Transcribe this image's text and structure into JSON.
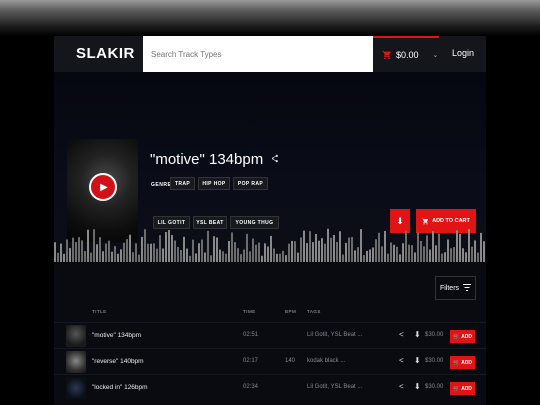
{
  "brand": "SLAKIR",
  "search": {
    "placeholder": "Search Track Types"
  },
  "cart": {
    "total": "$0.00"
  },
  "nav": {
    "login": "Login"
  },
  "track": {
    "title": "\"motive\" 134bpm",
    "genre_label": "GENRE",
    "genres": [
      "TRAP",
      "HIP HOP",
      "POP RAP"
    ],
    "tags": [
      "LIL GOTIT",
      "YSL BEAT",
      "YOUNG THUG"
    ],
    "add_to_cart": "ADD TO CART"
  },
  "filters": {
    "label": "Filters"
  },
  "table": {
    "headers": {
      "title": "TITLE",
      "time": "TIME",
      "bpm": "BPM",
      "tags": "TAGS"
    },
    "rows": [
      {
        "title": "\"motive\" 134bpm",
        "time": "02:51",
        "bpm": "",
        "tags": "Lil Gotit, YSL Beat ...",
        "price": "$30.00",
        "add": "ADD"
      },
      {
        "title": "\"reverse\" 140bpm",
        "time": "02:17",
        "bpm": "140",
        "tags": "kodak black ...",
        "price": "$30.00",
        "add": "ADD"
      },
      {
        "title": "\"locked in\" 126bpm",
        "time": "02:34",
        "bpm": "",
        "tags": "Lil Gotit, YSL Beat ...",
        "price": "$30.00",
        "add": "ADD"
      }
    ]
  },
  "colors": {
    "accent": "#e01414",
    "background": "#07090f"
  },
  "icons": [
    "cart-icon",
    "chevron-down-icon",
    "play-icon",
    "share-icon",
    "download-icon",
    "filter-icon"
  ]
}
